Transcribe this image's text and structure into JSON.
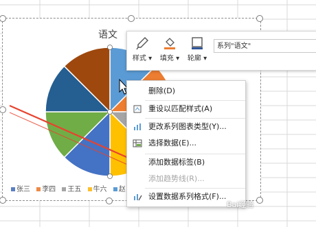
{
  "chart": {
    "title": "语文",
    "legend": [
      {
        "label": "张三",
        "color": "#5b7fc2"
      },
      {
        "label": "李四",
        "color": "#ed8a46"
      },
      {
        "label": "王五",
        "color": "#a5a5a5"
      },
      {
        "label": "牛六",
        "color": "#fcbf2d"
      },
      {
        "label": "赵",
        "color": "#5b9bd5"
      }
    ]
  },
  "mini_toolbar": {
    "style_label": "样式",
    "fill_label": "填充",
    "outline_label": "轮廓",
    "series_select": "系列\"语文\""
  },
  "context_menu": {
    "items": [
      {
        "label": "删除(D)",
        "icon": "none",
        "disabled": false
      },
      {
        "label": "重设以匹配样式(A)",
        "icon": "reset-style-icon",
        "disabled": false
      },
      {
        "label": "更改系列图表类型(Y)...",
        "icon": "chart-type-icon",
        "disabled": false
      },
      {
        "label": "选择数据(E)...",
        "icon": "select-data-icon",
        "disabled": false
      },
      {
        "label": "添加数据标签(B)",
        "icon": "none",
        "disabled": false
      },
      {
        "label": "添加趋势线(R)...",
        "icon": "none",
        "disabled": true
      },
      {
        "label": "设置数据系列格式(F)...",
        "icon": "format-series-icon",
        "disabled": false
      }
    ]
  },
  "watermark": "Bai经验"
}
